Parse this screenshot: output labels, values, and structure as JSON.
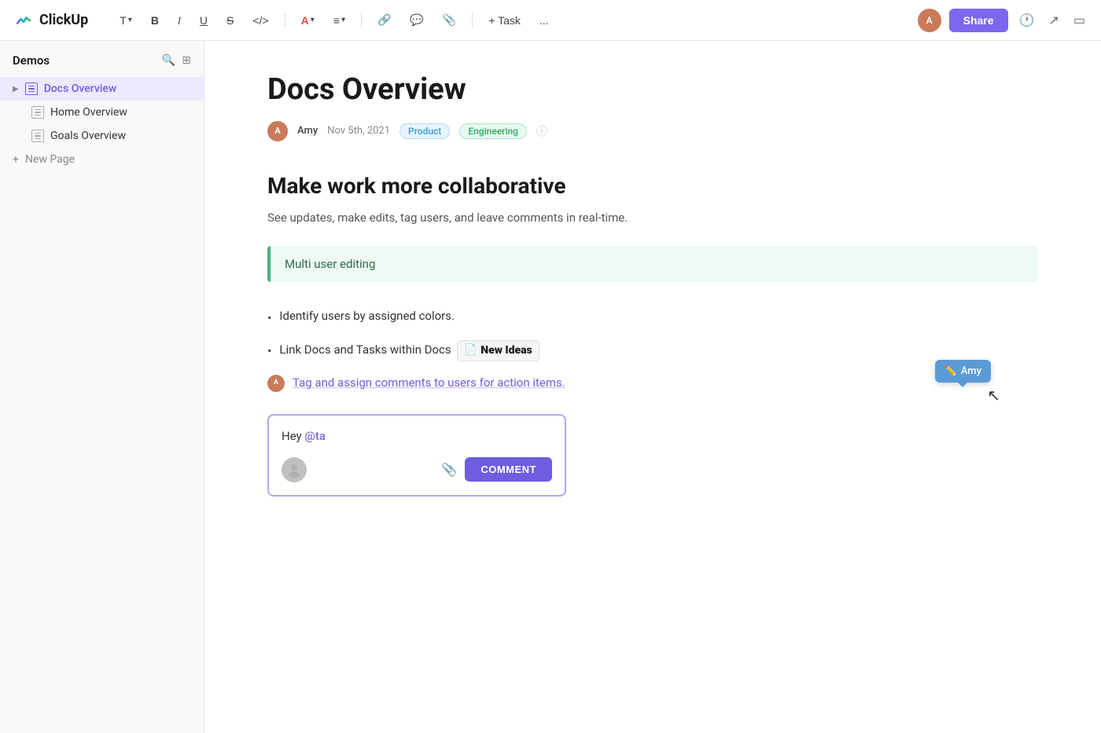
{
  "app": {
    "logo_text": "ClickUp",
    "share_label": "Share"
  },
  "toolbar": {
    "text_label": "T",
    "bold_label": "B",
    "italic_label": "I",
    "underline_label": "U",
    "strikethrough_label": "S",
    "code_label": "</>",
    "color_label": "A",
    "align_label": "≡",
    "link_label": "🔗",
    "comment_label": "💬",
    "attach_label": "📎",
    "task_label": "+ Task",
    "more_label": "...",
    "user_initials": "A"
  },
  "sidebar": {
    "title": "Demos",
    "items": [
      {
        "label": "Docs Overview",
        "active": true,
        "type": "doc-active"
      },
      {
        "label": "Home Overview",
        "active": false,
        "type": "doc"
      },
      {
        "label": "Goals Overview",
        "active": false,
        "type": "doc"
      }
    ],
    "new_page_label": "New Page"
  },
  "doc": {
    "title": "Docs Overview",
    "author": "Amy",
    "date": "Nov 5th, 2021",
    "tags": [
      "Product",
      "Engineering"
    ],
    "heading": "Make work more collaborative",
    "subtext": "See updates, make edits, tag users, and leave comments in real-time.",
    "callout": "Multi user editing",
    "bullets": [
      {
        "text": "Identify users by assigned colors."
      },
      {
        "text": "Link Docs and Tasks within Docs",
        "has_chip": true,
        "chip_label": "New Ideas"
      },
      {
        "text": "Tag and assign comments to users for action items.",
        "is_tagged": true,
        "has_tooltip": true
      }
    ],
    "tooltip_user": "Amy",
    "comment_text_before": "Hey ",
    "comment_at": "@ta",
    "comment_btn": "COMMENT"
  }
}
